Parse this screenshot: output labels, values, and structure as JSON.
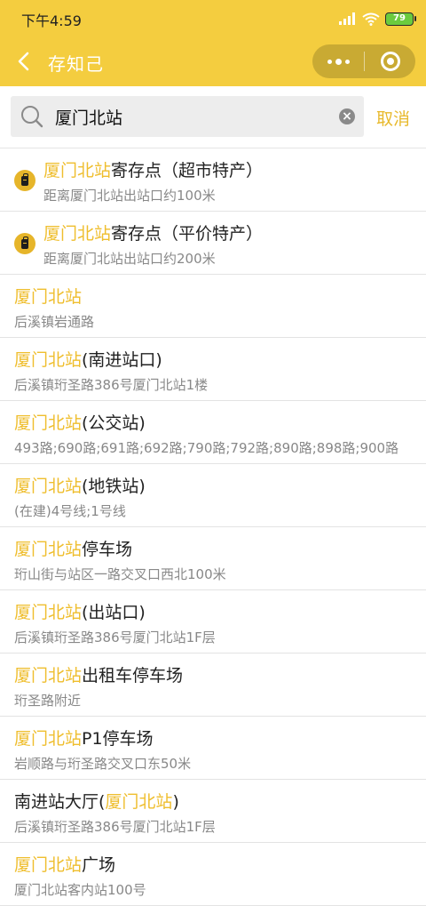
{
  "status": {
    "time": "下午4:59",
    "battery": "79"
  },
  "nav": {
    "title": "存知己"
  },
  "search": {
    "value": "厦门北站",
    "cancel_label": "取消"
  },
  "results": [
    {
      "hl": "厦门北站",
      "rest": "寄存点（超市特产）",
      "sub": "距离厦门北站出站口约100米",
      "icon": "locker-icon"
    },
    {
      "hl": "厦门北站",
      "rest": "寄存点（平价特产）",
      "sub": "距离厦门北站出站口约200米",
      "icon": "locker-icon"
    },
    {
      "hl": "厦门北站",
      "rest": "",
      "sub": "后溪镇岩通路"
    },
    {
      "hl": "厦门北站",
      "rest": "(南进站口)",
      "sub": "后溪镇珩圣路386号厦门北站1楼"
    },
    {
      "hl": "厦门北站",
      "rest": "(公交站)",
      "sub": "493路;690路;691路;692路;790路;792路;890路;898路;900路"
    },
    {
      "hl": "厦门北站",
      "rest": "(地铁站)",
      "sub": "(在建)4号线;1号线"
    },
    {
      "hl": "厦门北站",
      "rest": "停车场",
      "sub": "珩山街与站区一路交叉口西北100米"
    },
    {
      "hl": "厦门北站",
      "rest": "(出站口)",
      "sub": "后溪镇珩圣路386号厦门北站1F层"
    },
    {
      "hl": "厦门北站",
      "rest": "出租车停车场",
      "sub": "珩圣路附近"
    },
    {
      "hl": "厦门北站",
      "rest": "P1停车场",
      "sub": "岩顺路与珩圣路交叉口东50米"
    },
    {
      "pre": "南进站大厅(",
      "hl": "厦门北站",
      "rest": ")",
      "sub": "后溪镇珩圣路386号厦门北站1F层"
    },
    {
      "hl": "厦门北站",
      "rest": "广场",
      "sub": "厦门北站客内站100号"
    }
  ]
}
